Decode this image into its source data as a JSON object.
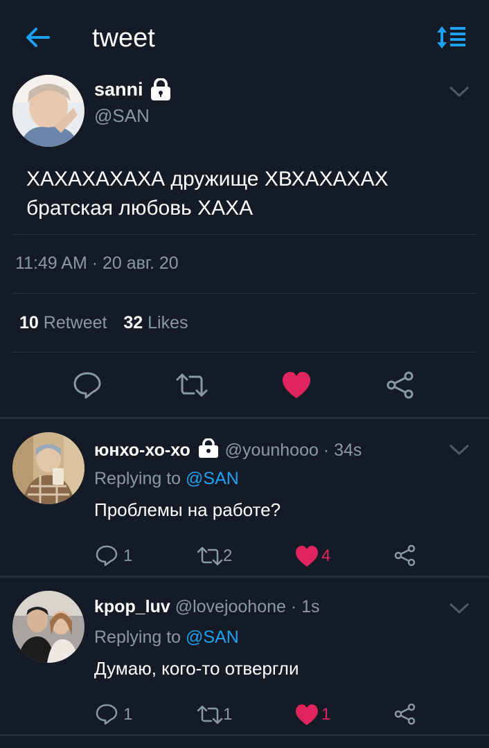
{
  "header": {
    "title": "tweet"
  },
  "tweet": {
    "display_name": "sanni",
    "handle": "@SAN",
    "text_line1": "ХАХАХАХАХА дружище ХВХАХАХАХ",
    "text_line2": "братская любовь ХАХА",
    "timestamp": "11:49 AM · 20 авг. 20",
    "retweets_count": "10",
    "retweets_label": "Retweet",
    "likes_count": "32",
    "likes_label": "Likes",
    "liked": true
  },
  "replies": [
    {
      "display_name": "юнхо-хо-хо",
      "handle": "@younhooo",
      "time": "· 34s",
      "replying_prefix": "Replying to",
      "replying_to": "@SAN",
      "text": "Проблемы на работе?",
      "reply_count": "1",
      "retweet_count": "2",
      "like_count": "4",
      "liked": true
    },
    {
      "display_name": "kpop_luv",
      "handle": "@lovejoohone",
      "time": "· 1s",
      "replying_prefix": "Replying to",
      "replying_to": "@SAN",
      "text": "Думаю, кого-то отвергли",
      "reply_count": "1",
      "retweet_count": "1",
      "like_count": "1",
      "liked": true
    }
  ],
  "colors": {
    "background": "#151b26",
    "accent": "#1da1f2",
    "like": "#e0245e",
    "muted": "#8899a6"
  }
}
